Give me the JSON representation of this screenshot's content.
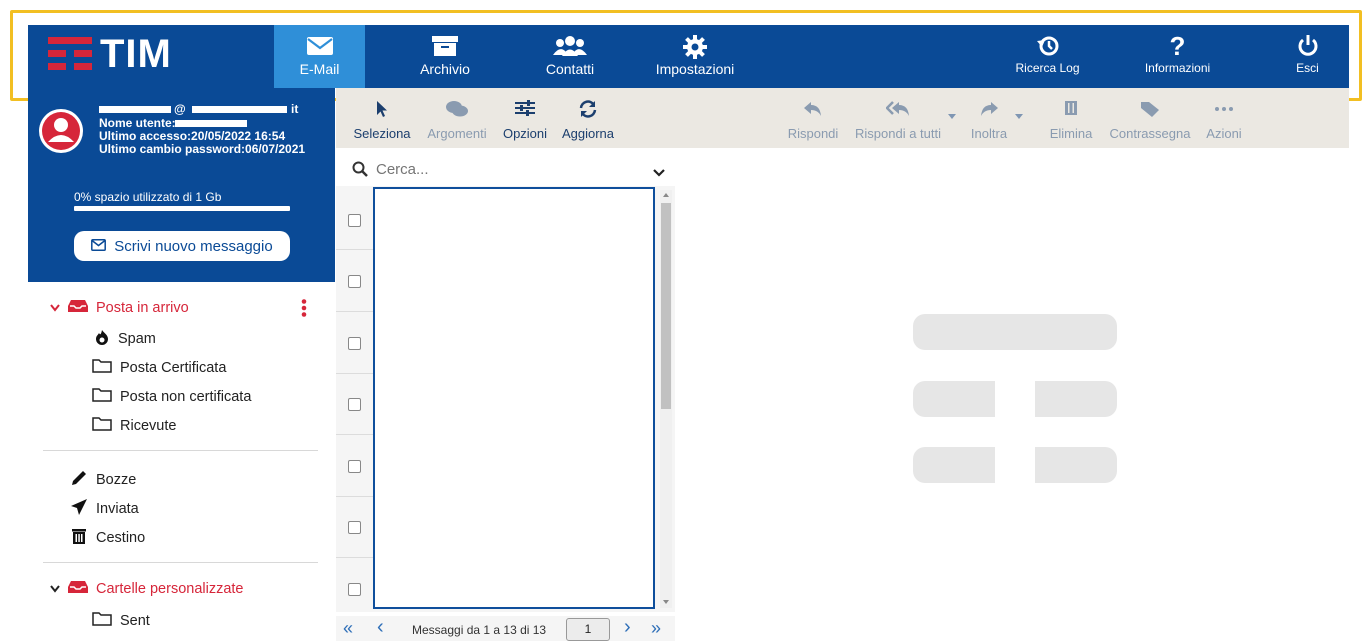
{
  "brand": {
    "name": "TIM",
    "accent": "#d6263a",
    "nav_bg": "#0a4a96",
    "active_tab_bg": "#2f8fd8"
  },
  "nav": {
    "email": "E-Mail",
    "archive": "Archivio",
    "contacts": "Contatti",
    "settings": "Impostazioni",
    "log": "Ricerca Log",
    "info": "Informazioni",
    "logout": "Esci"
  },
  "user": {
    "at": "@",
    "domain_suffix": "it",
    "username_label": "Nome utente:",
    "last_access": "Ultimo accesso:20/05/2022 16:54",
    "last_pw_change": "Ultimo cambio password:06/07/2021",
    "storage_text": "0% spazio utilizzato di 1 Gb",
    "storage_used_fraction": 0
  },
  "compose_label": "Scrivi nuovo messaggio",
  "folders": {
    "inbox": "Posta in arrivo",
    "spam": "Spam",
    "certified": "Posta Certificata",
    "uncertified": "Posta non certificata",
    "received": "Ricevute",
    "drafts": "Bozze",
    "sent": "Inviata",
    "trash": "Cestino",
    "custom": "Cartelle personalizzate",
    "custom_sent": "Sent"
  },
  "toolbar": {
    "select": "Seleziona",
    "topics": "Argomenti",
    "options": "Opzioni",
    "refresh": "Aggiorna",
    "reply": "Rispondi",
    "reply_all": "Rispondi a tutti",
    "forward": "Inoltra",
    "delete": "Elimina",
    "flag": "Contrassegna",
    "actions": "Azioni"
  },
  "search": {
    "placeholder": "Cerca..."
  },
  "pager": {
    "summary": "Messaggi da 1 a 13 di 13",
    "page": "1",
    "first": "«",
    "prev": "‹",
    "next": "›",
    "last": "»"
  }
}
